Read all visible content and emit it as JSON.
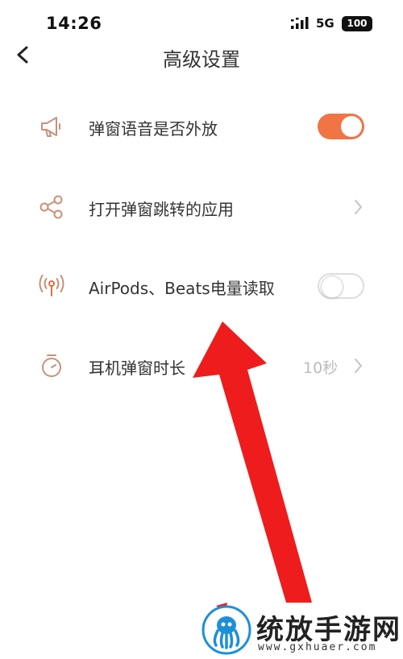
{
  "status_bar": {
    "time": "14:26",
    "network": "5G",
    "battery": "100"
  },
  "nav": {
    "title": "高级设置",
    "back_icon": "chevron-left-icon"
  },
  "settings": [
    {
      "label": "弹窗语音是否外放",
      "icon": "megaphone-icon",
      "control": "toggle",
      "checked": true
    },
    {
      "label": "打开弹窗跳转的应用",
      "icon": "share-icon",
      "control": "chevron"
    },
    {
      "label": "AirPods、Beats电量读取",
      "icon": "broadcast-icon",
      "control": "toggle",
      "checked": false
    },
    {
      "label": "耳机弹窗时长",
      "icon": "timer-icon",
      "control": "chevron",
      "value": "10秒"
    }
  ],
  "colors": {
    "accent": "#f07444",
    "icon": "#c8907a",
    "annotation_arrow": "#ee1c1c"
  },
  "watermark": {
    "title": "统放手游网",
    "url": "www.gxhuaer.com"
  }
}
